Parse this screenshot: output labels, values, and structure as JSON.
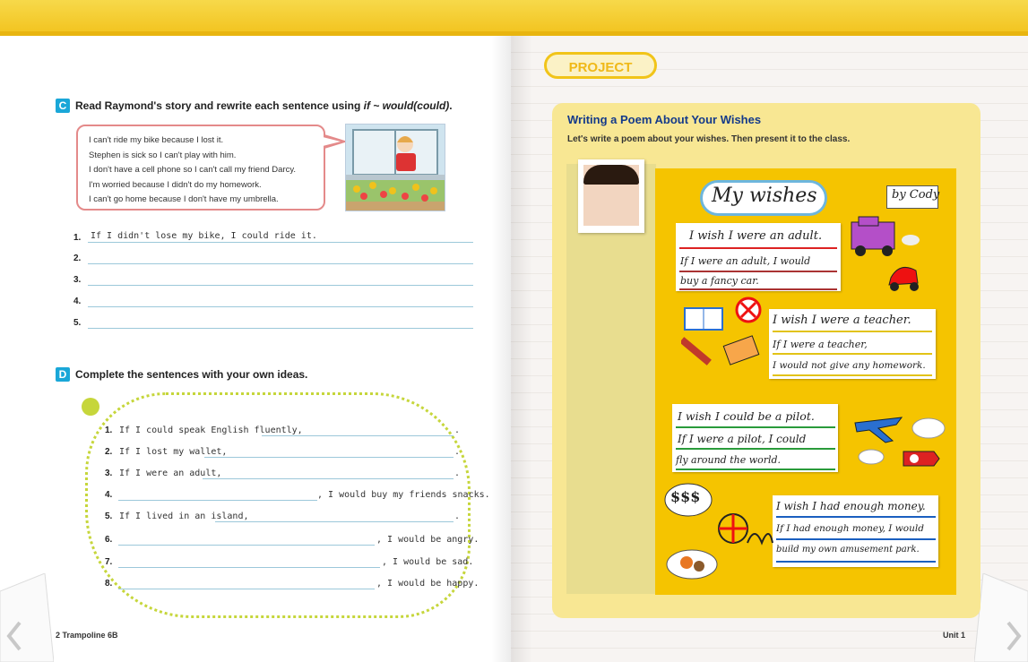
{
  "left_page": {
    "section_c": {
      "letter": "C",
      "instruction_prefix": "Read Raymond's story and rewrite each sentence using ",
      "instruction_pattern": "if ~ would(could)",
      "instruction_suffix": ".",
      "story_lines": [
        "I can't ride my bike because I lost it.",
        "Stephen is sick so I can't play with him.",
        "I don't have a cell phone so I can't call my friend Darcy.",
        "I'm worried because I didn't do my homework.",
        "I can't go home because I don't have my umbrella."
      ],
      "items": [
        {
          "num": "1.",
          "answer": "If I didn't lose my bike, I could ride it."
        },
        {
          "num": "2.",
          "answer": ""
        },
        {
          "num": "3.",
          "answer": ""
        },
        {
          "num": "4.",
          "answer": ""
        },
        {
          "num": "5.",
          "answer": ""
        }
      ]
    },
    "section_d": {
      "letter": "D",
      "instruction": "Complete the sentences with your own ideas.",
      "items": [
        {
          "num": "1.",
          "prefix": "If I could speak English fluently,",
          "suffix": "."
        },
        {
          "num": "2.",
          "prefix": "If I lost my wallet,",
          "suffix": "."
        },
        {
          "num": "3.",
          "prefix": "If I were an adult,",
          "suffix": "."
        },
        {
          "num": "4.",
          "prefix": "",
          "suffix": ", I would buy my friends snacks."
        },
        {
          "num": "5.",
          "prefix": "If I lived in an island,",
          "suffix": "."
        },
        {
          "num": "6.",
          "prefix": "",
          "suffix": ", I would be angry."
        },
        {
          "num": "7.",
          "prefix": "",
          "suffix": ", I would be sad."
        },
        {
          "num": "8.",
          "prefix": "",
          "suffix": ", I would be happy."
        }
      ]
    },
    "footer": "2 Trampoline 6B"
  },
  "right_page": {
    "badge": "PROJECT",
    "title": "Writing a Poem About Your Wishes",
    "subtitle": "Let's write a poem about your wishes. Then present it to the class.",
    "poster": {
      "heading": "My wishes",
      "author": "by Cody",
      "stanzas": [
        [
          "I wish I were an adult.",
          "If I were an adult, I would",
          "buy a fancy car."
        ],
        [
          "I wish I were a teacher.",
          "If I were a teacher,",
          "I would not give any homework."
        ],
        [
          "I wish I could be a pilot.",
          "If I were a pilot, I could",
          "fly around the world."
        ],
        [
          "I wish I had enough money.",
          "If I had enough money, I would",
          "build my own amusement park."
        ]
      ],
      "money_doodle": "$$$"
    },
    "footer": "Unit 1"
  },
  "colors": {
    "accent_blue": "#1aa7d8",
    "project_yellow": "#f1c419",
    "title_blue": "#143a8a",
    "poster_yellow": "#f5c400"
  }
}
